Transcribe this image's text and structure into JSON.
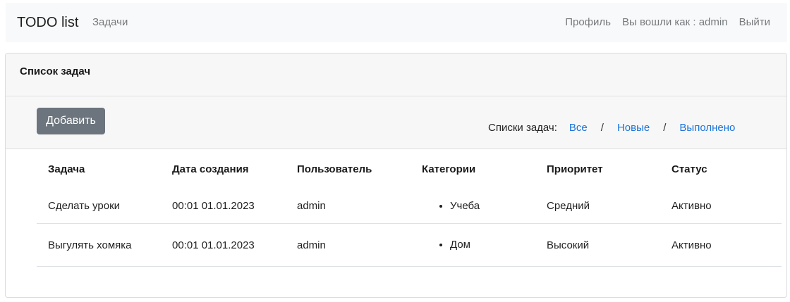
{
  "navbar": {
    "brand": "TODO list",
    "tasks_link": "Задачи",
    "profile_link": "Профиль",
    "logged_in_as": "Вы вошли как : admin",
    "logout_link": "Выйти"
  },
  "card": {
    "title": "Список задач",
    "add_button": "Добавить",
    "filters": {
      "label": "Списки задач:",
      "all": "Все",
      "separator": "/",
      "new": "Новые",
      "done": "Выполнено"
    }
  },
  "table": {
    "headers": [
      "Задача",
      "Дата создания",
      "Пользователь",
      "Категории",
      "Приоритет",
      "Статус"
    ],
    "rows": [
      {
        "task": "Сделать уроки",
        "created": "00:01 01.01.2023",
        "user": "admin",
        "category": "Учеба",
        "priority": "Средний",
        "status": "Активно"
      },
      {
        "task": "Выгулять хомяка",
        "created": "00:01 01.01.2023",
        "user": "admin",
        "category": "Дом",
        "priority": "Высокий",
        "status": "Активно"
      }
    ]
  },
  "colors": {
    "navbar_bg": "#f8f9fa",
    "button_secondary": "#6c757d",
    "link_blue": "#1a73d9"
  }
}
